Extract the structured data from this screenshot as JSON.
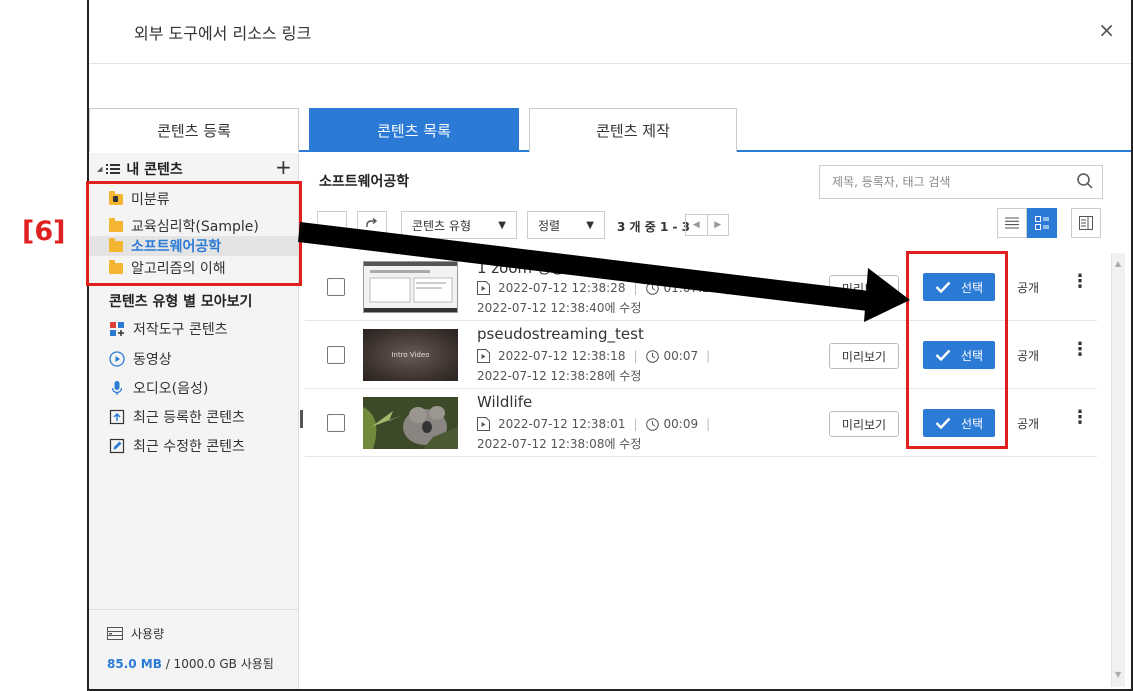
{
  "annotation": {
    "step_label": "[6]"
  },
  "dialog": {
    "title": "외부 도구에서 리소스 링크",
    "close_symbol": "×"
  },
  "tabs": [
    {
      "label": "콘텐츠 등록",
      "active": false
    },
    {
      "label": "콘텐츠 목록",
      "active": true
    },
    {
      "label": "콘텐츠 제작",
      "active": false
    }
  ],
  "sidebar": {
    "tree_toggle": "◢",
    "header_label": "내 콘텐츠",
    "add_symbol": "+",
    "folders": [
      {
        "label": "미분류",
        "icon": "locked-folder-icon"
      },
      {
        "label": "교육심리학(Sample)",
        "icon": "folder-icon"
      },
      {
        "label": "소프트웨어공학",
        "icon": "folder-icon",
        "selected": true
      },
      {
        "label": "알고리즘의 이해",
        "icon": "folder-icon"
      }
    ],
    "category_header": "콘텐츠 유형 별 모아보기",
    "categories": [
      {
        "label": "저작도구 콘텐츠",
        "icon": "authoring-tool-icon"
      },
      {
        "label": "동영상",
        "icon": "video-icon"
      },
      {
        "label": "오디오(음성)",
        "icon": "microphone-icon"
      },
      {
        "label": "최근 등록한 콘텐츠",
        "icon": "upload-icon"
      },
      {
        "label": "최근 수정한 콘텐츠",
        "icon": "edit-icon"
      }
    ],
    "usage": {
      "label": "사용량",
      "used": "85.0 MB",
      "total": "/ 1000.0 GB 사용됨"
    }
  },
  "main": {
    "folder_title": "소프트웨어공학",
    "search_placeholder": "제목, 등록자, 태그 검색",
    "type_filter": "콘텐츠 유형",
    "sort_label": "정렬",
    "count_text": "3 개 중 1 - 3",
    "pager_prev": "◀",
    "pager_next": "▶",
    "rows": [
      {
        "title": "1 zoom 영상",
        "registered": "2022-07-12 12:38:28",
        "duration": "01:07:22",
        "modified": "2022-07-12 12:38:40에 수정",
        "preview": "미리보기",
        "select": "선택",
        "visibility": "공개",
        "more": "⋮"
      },
      {
        "title": "pseudostreaming_test",
        "registered": "2022-07-12 12:38:18",
        "duration": "00:07",
        "modified": "2022-07-12 12:38:28에 수정",
        "preview": "미리보기",
        "select": "선택",
        "visibility": "공개",
        "more": "⋮",
        "thumb_text": "Intro Video"
      },
      {
        "title": "Wildlife",
        "registered": "2022-07-12 12:38:01",
        "duration": "00:09",
        "modified": "2022-07-12 12:38:08에 수정",
        "preview": "미리보기",
        "select": "선택",
        "visibility": "공개",
        "more": "⋮"
      }
    ],
    "scroll_up": "▲",
    "scroll_down": "▼"
  },
  "colors": {
    "accent": "#2b7bd6",
    "annotation_red": "#e0201e",
    "folder_yellow": "#f4b630"
  }
}
